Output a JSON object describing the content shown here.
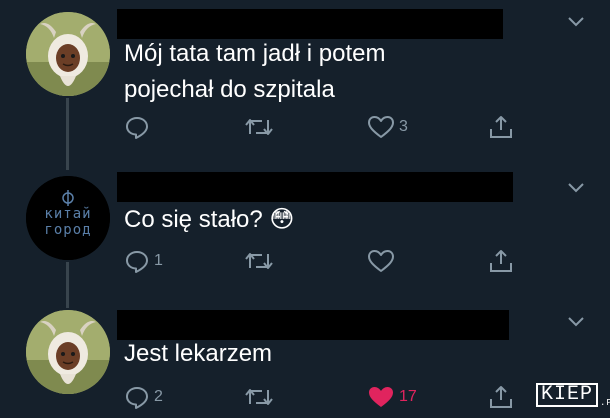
{
  "tweets": [
    {
      "author": "goat",
      "text_line1": "Mój tata tam jadł i potem",
      "text_line2": "pojechał do szpitala",
      "replies": "",
      "likes": "3",
      "liked": false
    },
    {
      "author": "kitai-gorod",
      "avatar_text1": "китай",
      "avatar_text2": "город",
      "text": "Co się stało? 😳",
      "replies": "1",
      "likes": "",
      "liked": false
    },
    {
      "author": "goat",
      "text": "Jest lekarzem",
      "replies": "2",
      "likes": "17",
      "liked": true
    }
  ],
  "watermark": {
    "brand": "KIEP",
    "tld": ".PL"
  },
  "colors": {
    "background": "#15202b",
    "icon": "#8899a6",
    "like_active": "#e0245e",
    "thread": "#38444d"
  },
  "icons": [
    "reply-icon",
    "retweet-icon",
    "like-icon",
    "share-icon",
    "chevron-down-icon"
  ]
}
